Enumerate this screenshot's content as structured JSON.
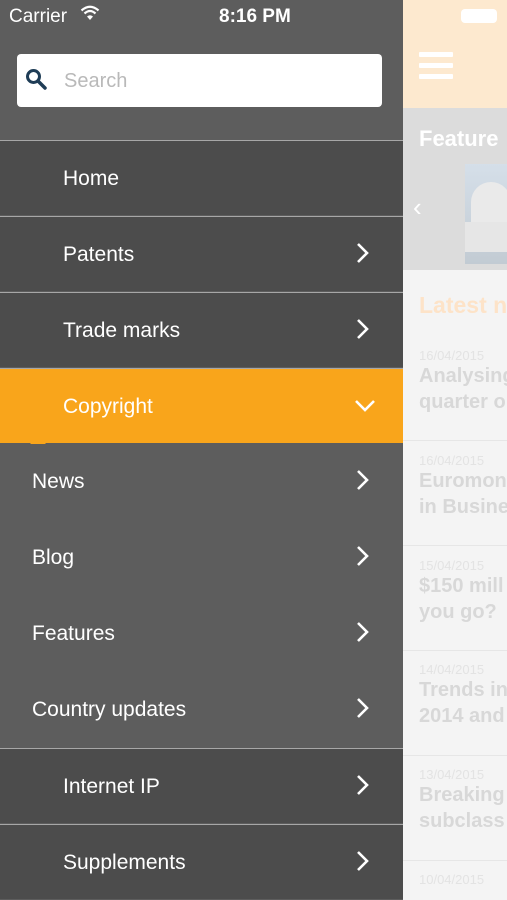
{
  "status_bar": {
    "carrier": "Carrier",
    "time": "8:16 PM"
  },
  "search": {
    "placeholder": "Search"
  },
  "menu": {
    "home": "Home",
    "patents": "Patents",
    "trade_marks": "Trade marks",
    "copyright": "Copyright",
    "news": "News",
    "blog": "Blog",
    "features": "Features",
    "country_updates": "Country updates",
    "internet_ip": "Internet IP",
    "supplements": "Supplements"
  },
  "background": {
    "featured_title": "Feature",
    "latest_title": "Latest n",
    "articles": [
      {
        "date": "16/04/2015",
        "line1": "Analysing",
        "line2": "quarter o"
      },
      {
        "date": "16/04/2015",
        "line1": "Euromon",
        "line2": "in Busine"
      },
      {
        "date": "15/04/2015",
        "line1": "$150 mill",
        "line2": "you go?"
      },
      {
        "date": "14/04/2015",
        "line1": "Trends in",
        "line2": "2014 and"
      },
      {
        "date": "13/04/2015",
        "line1": "Breaking",
        "line2": "subclass"
      },
      {
        "date": "10/04/2015",
        "line1": "",
        "line2": ""
      }
    ]
  },
  "colors": {
    "accent": "#f9a51b",
    "drawer_bg": "#5d5d5d",
    "sub_bg": "#4c4c4c"
  }
}
